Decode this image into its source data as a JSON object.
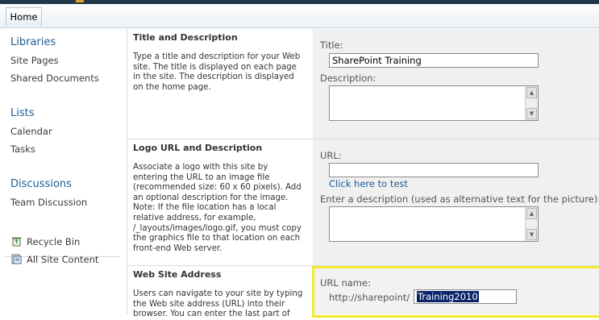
{
  "ribbon": {
    "home_tab": "Home"
  },
  "leftnav": {
    "libraries": {
      "heading": "Libraries",
      "items": [
        "Site Pages",
        "Shared Documents"
      ]
    },
    "lists": {
      "heading": "Lists",
      "items": [
        "Calendar",
        "Tasks"
      ]
    },
    "discussions": {
      "heading": "Discussions",
      "items": [
        "Team Discussion"
      ]
    },
    "recycle_bin": "Recycle Bin",
    "all_site_content": "All Site Content"
  },
  "sections": {
    "title_desc": {
      "title": "Title and Description",
      "description": "Type a title and description for your Web site. The title is displayed on each page in the site. The description is displayed on the home page.",
      "title_label": "Title:",
      "title_value": "SharePoint Training",
      "description_label": "Description:",
      "description_value": ""
    },
    "logo": {
      "title": "Logo URL and Description",
      "description": "Associate a logo with this site by entering the URL to an image file (recommended size: 60 x 60 pixels). Add an optional description for the image. Note: If the file location has a local relative address, for example, /_layouts/images/logo.gif, you must copy the graphics file to that location on each front-end Web server.",
      "url_label": "URL:",
      "url_value": "",
      "test_link": "Click here to test",
      "alt_label": "Enter a description (used as alternative text for the picture):",
      "alt_value": ""
    },
    "address": {
      "title": "Web Site Address",
      "description": "Users can navigate to your site by typing the Web site address (URL) into their browser. You can enter the last part of",
      "url_name_label": "URL name:",
      "url_prefix": "http://sharepoint/",
      "url_value": "Training2010"
    }
  },
  "colors": {
    "accent_link": "#1f5b94",
    "highlight": "#f1ea2f",
    "selection": "#0a246a",
    "top_bar": "#21374c"
  }
}
